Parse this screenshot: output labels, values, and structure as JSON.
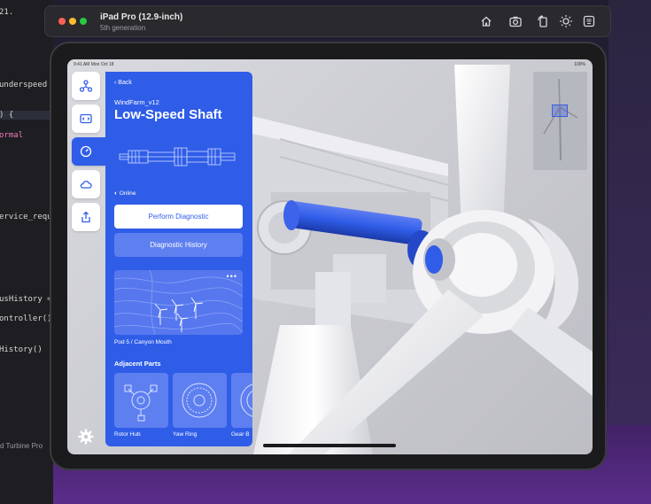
{
  "editor": {
    "lines": [
      {
        "text": "21.",
        "kind": "plain"
      },
      {
        "text": "underspeed",
        "kind": "plain"
      },
      {
        "text": ") {",
        "kind": "plain"
      },
      {
        "text": "ormal",
        "kind": "kw"
      },
      {
        "text": "ervice_requi",
        "kind": "plain"
      },
      {
        "text": "usHistory =",
        "kind": "plain"
      },
      {
        "text": "ontroller()",
        "kind": "plain"
      },
      {
        "text": "History()",
        "kind": "plain"
      }
    ],
    "footer": "d Turbine Pro"
  },
  "simulator": {
    "device": "iPad Pro (12.9-inch)",
    "generation": "5th generation",
    "toolbar_icons": [
      "home-icon",
      "screenshot-icon",
      "rotate-icon",
      "appearance-icon",
      "keyboard-icon"
    ]
  },
  "status_bar": {
    "time": "9:41 AM   Mon Oct 18",
    "battery": "100%"
  },
  "toolbar": {
    "items": [
      {
        "name": "network-icon",
        "active": false
      },
      {
        "name": "code-icon",
        "active": false
      },
      {
        "name": "gauge-icon",
        "active": true
      },
      {
        "name": "cloud-icon",
        "active": false
      },
      {
        "name": "share-icon",
        "active": false
      }
    ],
    "settings_icon": "gear-icon"
  },
  "panel": {
    "back_label": "Back",
    "subtitle": "WindFarm_v12",
    "title": "Low-Speed Shaft",
    "status": "Online",
    "primary_button": "Perform Diagnostic",
    "secondary_button": "Diagnostic History",
    "map_label": "Pod 5 / Canyon Mouth",
    "map_more": "•••",
    "adjacent_title": "Adjacent Parts",
    "adjacent_parts": [
      {
        "label": "Rotor Hub"
      },
      {
        "label": "Yaw Ring"
      },
      {
        "label": "Gear B"
      }
    ]
  },
  "colors": {
    "accent": "#2f5de8",
    "panel_secondary": "#5e7ff0"
  }
}
